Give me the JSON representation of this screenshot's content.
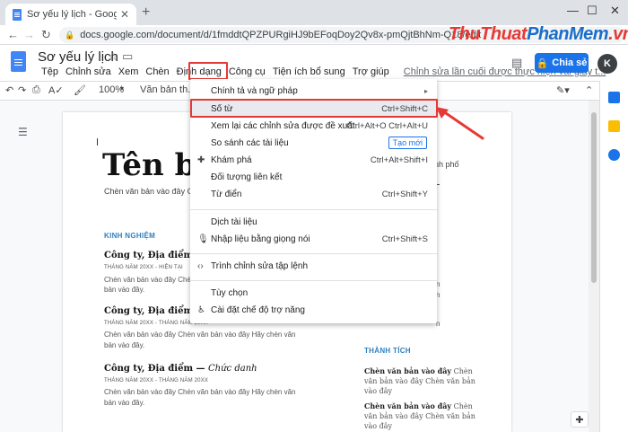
{
  "browser": {
    "tab_title": "Sơ yếu lý lịch - Google Tài liệu",
    "url": "docs.google.com/document/d/1fmddtQPZPURgiHJ9bEFoqDoy2Qv8x-pmQjtBhNm-Q18/edit"
  },
  "watermark": {
    "part1": "ThuThuat",
    "part2": "PhanMem",
    "part3": ".vn"
  },
  "docs": {
    "title": "Sơ yếu lý lịch",
    "menu": [
      "Tệp",
      "Chỉnh sửa",
      "Xem",
      "Chèn",
      "Định dạng",
      "Công cụ",
      "Tiện ích bổ sung",
      "Trợ giúp"
    ],
    "last_edit": "Chỉnh sửa lần cuối được thực hiện vài giây t...",
    "share_label": "Chia sẻ",
    "avatar_letter": "K"
  },
  "toolbar": {
    "zoom": "100%",
    "style": "Văn bản th..."
  },
  "document": {
    "name": "Tên bạ",
    "contact": "Chèn văn bản vào đây Chèn v",
    "right_fragment1": "nh phố",
    "section_experience": "KINH NGHIỆM",
    "jobs": [
      {
        "company": "Công ty, Địa điểm — ",
        "title": "C",
        "date": "THÁNG NĂM 20XX - HIỆN TẠI",
        "line1": "Chèn văn bản vào đây Chèn",
        "line2": "bản vào đây."
      },
      {
        "company": "Công ty, Địa điểm — ",
        "title": "C",
        "date": "THÁNG NĂM 20XX - THÁNG NĂM 20XX",
        "line1": "Chèn văn bản vào đây Chèn văn bản vào đây Hãy chèn văn",
        "line2": "bản vào đây."
      },
      {
        "company": "Công ty, Địa điểm — ",
        "title": "Chức danh",
        "date": "THÁNG NĂM 20XX - THÁNG NĂM 20XX",
        "line1": "Chèn văn bản vào đây Chèn văn bản vào đây Hãy chèn văn",
        "line2": "bản vào đây."
      }
    ],
    "right_col_fragments": [
      "n",
      "n",
      "n",
      "n"
    ],
    "section_achievements": "THÀNH TÍCH",
    "achievements": [
      {
        "bold": "Chèn văn bản vào đây",
        "rest": " Chèn",
        "line2": "văn bản vào đây Chèn văn bản",
        "line3": "vào đây"
      },
      {
        "bold": "Chèn văn bản vào đây",
        "rest": " Chèn",
        "line2": "văn bản vào đây Chèn văn bản",
        "line3": "vào đây"
      }
    ]
  },
  "dropdown": {
    "items": [
      {
        "label": "Chính tả và ngữ pháp",
        "shortcut": "",
        "icon": "",
        "arrow": "▸"
      },
      {
        "label": "Số từ",
        "shortcut": "Ctrl+Shift+C",
        "icon": ""
      },
      {
        "label": "Xem lại các chỉnh sửa được đề xuất",
        "shortcut": "Ctrl+Alt+O Ctrl+Alt+U",
        "icon": ""
      },
      {
        "label": "So sánh các tài liệu",
        "shortcut": "",
        "icon": "",
        "badge": "Tạo mới"
      },
      {
        "label": "Khám phá",
        "shortcut": "Ctrl+Alt+Shift+I",
        "icon": "explore-icon"
      },
      {
        "label": "Đối tượng liên kết",
        "shortcut": "",
        "icon": ""
      },
      {
        "label": "Từ điển",
        "shortcut": "Ctrl+Shift+Y",
        "icon": ""
      },
      {
        "label": "Dịch tài liệu",
        "shortcut": "",
        "icon": ""
      },
      {
        "label": "Nhập liệu bằng giọng nói",
        "shortcut": "Ctrl+Shift+S",
        "icon": "microphone-icon"
      },
      {
        "label": "Trình chỉnh sửa tập lệnh",
        "shortcut": "",
        "icon": "code-icon"
      },
      {
        "label": "Tùy chọn",
        "shortcut": "",
        "icon": ""
      },
      {
        "label": "Cài đặt chế độ trợ năng",
        "shortcut": "",
        "icon": "accessibility-icon"
      }
    ]
  },
  "colors": {
    "accent": "#1a73e8",
    "highlight_box": "#e53935",
    "section": "#2f7fbf"
  }
}
